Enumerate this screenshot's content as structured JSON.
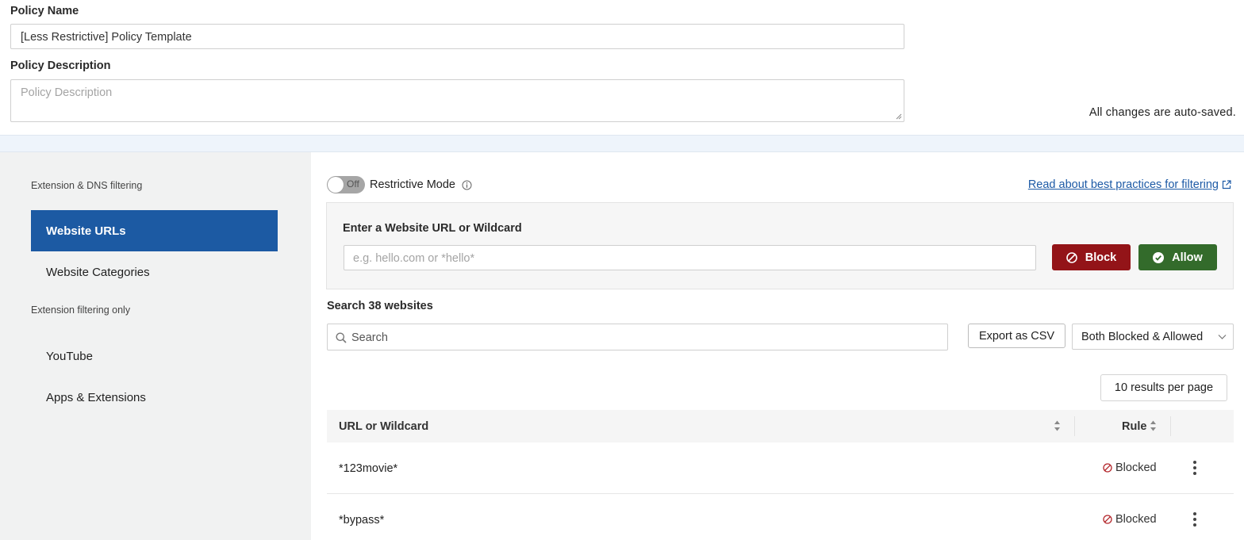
{
  "policy": {
    "name_label": "Policy Name",
    "name_value": "[Less Restrictive] Policy Template",
    "description_label": "Policy Description",
    "description_placeholder": "Policy Description",
    "autosave_text": "All changes are auto-saved."
  },
  "sidebar": {
    "section1": "Extension & DNS filtering",
    "items1": [
      {
        "label": "Website URLs",
        "active": true
      },
      {
        "label": "Website Categories",
        "active": false
      }
    ],
    "section2": "Extension filtering only",
    "items2": [
      {
        "label": "YouTube"
      },
      {
        "label": "Apps & Extensions"
      }
    ]
  },
  "main": {
    "toggle_state": "Off",
    "restrictive_label": "Restrictive Mode",
    "best_practices_link": "Read about best practices for filtering",
    "entry": {
      "label": "Enter a Website URL or Wildcard",
      "placeholder": "e.g. hello.com or *hello*",
      "block_label": "Block",
      "allow_label": "Allow"
    },
    "search": {
      "title": "Search 38 websites",
      "placeholder": "Search",
      "export_label": "Export as CSV",
      "filter_value": "Both Blocked & Allowed",
      "per_page": "10 results per page"
    },
    "table": {
      "col_url": "URL or Wildcard",
      "col_rule": "Rule",
      "rows": [
        {
          "url": "*123movie*",
          "rule": "Blocked"
        },
        {
          "url": "*bypass*",
          "rule": "Blocked"
        }
      ]
    }
  },
  "colors": {
    "primary": "#1c5aa3",
    "block": "#931418",
    "allow": "#336b2b",
    "blocked_icon": "#b3262b"
  }
}
